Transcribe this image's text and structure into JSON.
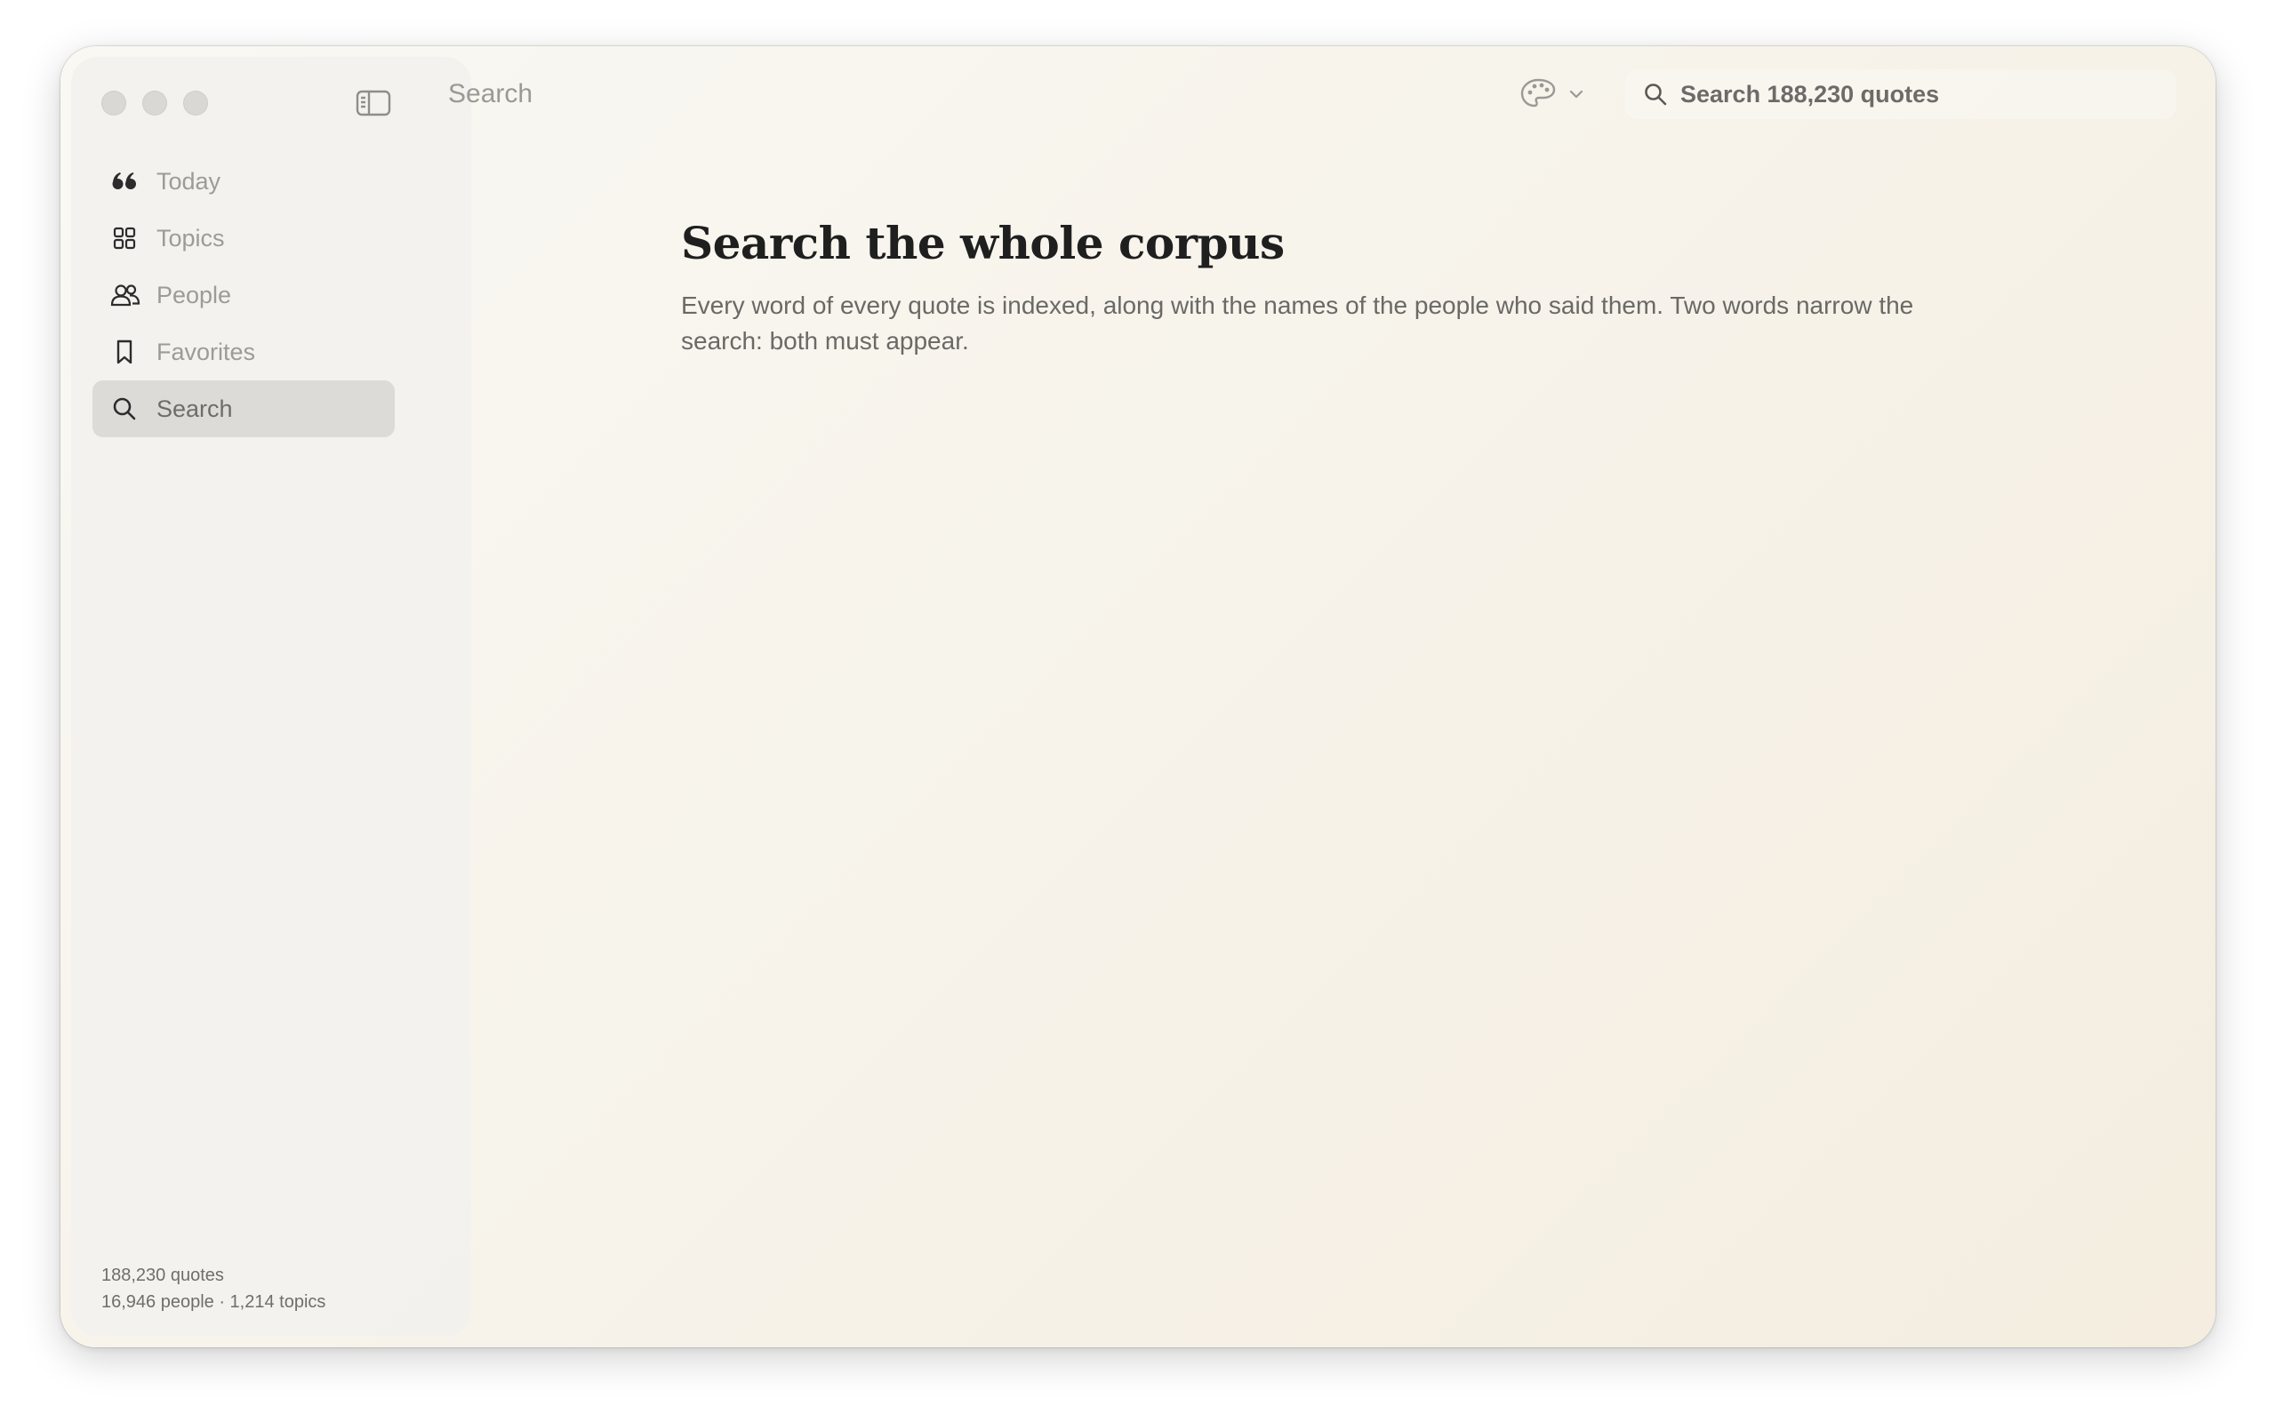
{
  "window": {
    "traffic_lights": [
      "close",
      "minimize",
      "zoom"
    ]
  },
  "sidebar": {
    "items": [
      {
        "label": "Today",
        "icon": "quote-icon",
        "active": false
      },
      {
        "label": "Topics",
        "icon": "grid-icon",
        "active": false
      },
      {
        "label": "People",
        "icon": "people-icon",
        "active": false
      },
      {
        "label": "Favorites",
        "icon": "bookmark-icon",
        "active": false
      },
      {
        "label": "Search",
        "icon": "search-icon",
        "active": true
      }
    ],
    "stats_line1": "188,230 quotes",
    "stats_line2": "16,946 people · 1,214 topics"
  },
  "toolbar": {
    "title": "Search",
    "theme_icon": "palette-icon",
    "search_placeholder": "Search 188,230 quotes"
  },
  "main": {
    "heading": "Search the whole corpus",
    "description": "Every word of every quote is indexed, along with the names of the people who said them. Two words narrow the search: both must appear."
  }
}
